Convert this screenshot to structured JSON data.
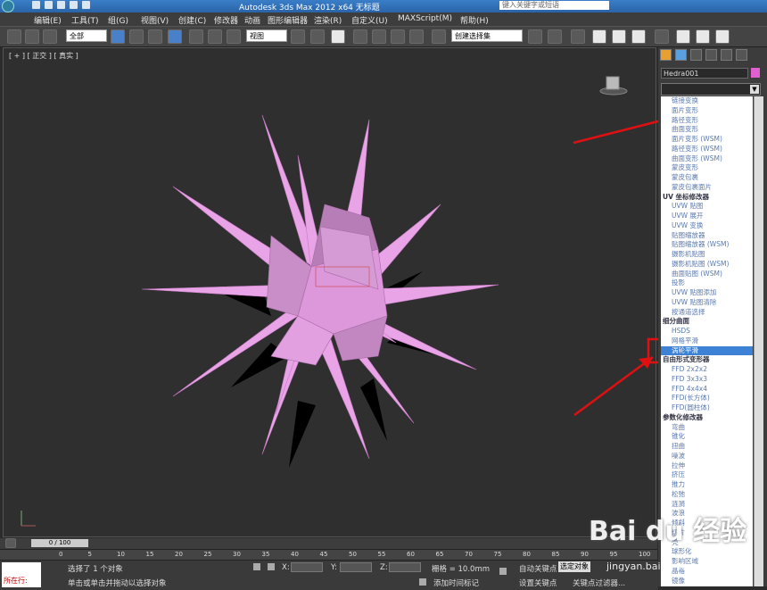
{
  "titlebar": {
    "title": "Autodesk 3ds Max  2012 x64    无标题",
    "search_placeholder": "键入关键字或短语"
  },
  "menu": [
    "编辑(E)",
    "工具(T)",
    "组(G)",
    "视图(V)",
    "创建(C)",
    "修改器",
    "动画",
    "图形编辑器",
    "渲染(R)",
    "自定义(U)",
    "MAXScript(M)",
    "帮助(H)"
  ],
  "toolbar": {
    "selection_filter": "全部",
    "reference_coord": "视图",
    "named_selection": "创建选择集"
  },
  "viewport": {
    "label": "[ + ] [ 正交 ] [ 真实 ]",
    "object_color": "#e79be0",
    "shadow_color": "#000000"
  },
  "command_panel": {
    "object_name": "Hedra001",
    "object_color": "#e060d0",
    "modifier_list": [
      {
        "label": "链接变换",
        "type": "item"
      },
      {
        "label": "面片变形",
        "type": "item"
      },
      {
        "label": "路径变形",
        "type": "item"
      },
      {
        "label": "曲面变形",
        "type": "item"
      },
      {
        "label": "面片变形 (WSM)",
        "type": "item"
      },
      {
        "label": "路径变形 (WSM)",
        "type": "item"
      },
      {
        "label": "曲面变形 (WSM)",
        "type": "item"
      },
      {
        "label": "蒙皮变形",
        "type": "item"
      },
      {
        "label": "蒙皮包裹",
        "type": "item"
      },
      {
        "label": "蒙皮包裹面片",
        "type": "item"
      },
      {
        "label": "UV 坐标修改器",
        "type": "cat"
      },
      {
        "label": "UVW 贴图",
        "type": "item"
      },
      {
        "label": "UVW 展开",
        "type": "item"
      },
      {
        "label": "UVW 变换",
        "type": "item"
      },
      {
        "label": "贴图缩放器",
        "type": "item"
      },
      {
        "label": "贴图缩放器 (WSM)",
        "type": "item"
      },
      {
        "label": "摄影机贴图",
        "type": "item"
      },
      {
        "label": "摄影机贴图 (WSM)",
        "type": "item"
      },
      {
        "label": "曲面贴图 (WSM)",
        "type": "item"
      },
      {
        "label": "投影",
        "type": "item"
      },
      {
        "label": "UVW 贴图添加",
        "type": "item"
      },
      {
        "label": "UVW 贴图清除",
        "type": "item"
      },
      {
        "label": "按通道选择",
        "type": "item"
      },
      {
        "label": "细分曲面",
        "type": "cat"
      },
      {
        "label": "HSDS",
        "type": "item"
      },
      {
        "label": "网格平滑",
        "type": "item"
      },
      {
        "label": "涡轮平滑",
        "type": "sel"
      },
      {
        "label": "自由形式变形器",
        "type": "cat"
      },
      {
        "label": "FFD 2x2x2",
        "type": "item"
      },
      {
        "label": "FFD 3x3x3",
        "type": "item"
      },
      {
        "label": "FFD 4x4x4",
        "type": "item"
      },
      {
        "label": "FFD(长方体)",
        "type": "item"
      },
      {
        "label": "FFD(圆柱体)",
        "type": "item"
      },
      {
        "label": "参数化修改器",
        "type": "cat"
      },
      {
        "label": "弯曲",
        "type": "item"
      },
      {
        "label": "锥化",
        "type": "item"
      },
      {
        "label": "扭曲",
        "type": "item"
      },
      {
        "label": "噪波",
        "type": "item"
      },
      {
        "label": "拉伸",
        "type": "item"
      },
      {
        "label": "挤压",
        "type": "item"
      },
      {
        "label": "推力",
        "type": "item"
      },
      {
        "label": "松弛",
        "type": "item"
      },
      {
        "label": "涟漪",
        "type": "item"
      },
      {
        "label": "波浪",
        "type": "item"
      },
      {
        "label": "倾斜",
        "type": "item"
      },
      {
        "label": "切片",
        "type": "item"
      },
      {
        "label": "壳",
        "type": "item"
      },
      {
        "label": "球形化",
        "type": "item"
      },
      {
        "label": "影响区域",
        "type": "item"
      },
      {
        "label": "晶格",
        "type": "item"
      },
      {
        "label": "镜像",
        "type": "item"
      }
    ]
  },
  "timeline": {
    "slider": "0 / 100",
    "ticks": [
      "0",
      "5",
      "10",
      "15",
      "20",
      "25",
      "30",
      "35",
      "40",
      "45",
      "50",
      "55",
      "60",
      "65",
      "70",
      "75",
      "80",
      "85",
      "90",
      "95",
      "100"
    ]
  },
  "status": {
    "maxscript_label": "所在行:",
    "selected": "选择了 1 个对象",
    "prompt": "单击或单击并拖动以选择对象",
    "x_label": "X:",
    "y_label": "Y:",
    "z_label": "Z:",
    "grid": "栅格 = 10.0mm",
    "add_time_tag": "添加时间标记",
    "auto_key": "自动关键点",
    "selected_obj": "选定对象",
    "set_key": "设置关键点",
    "key_filter": "关键点过滤器..."
  },
  "watermark": {
    "brand": "Bai du 经验",
    "url": "jingyan.baidu.com"
  },
  "annotations": {
    "color": "#e01010"
  }
}
